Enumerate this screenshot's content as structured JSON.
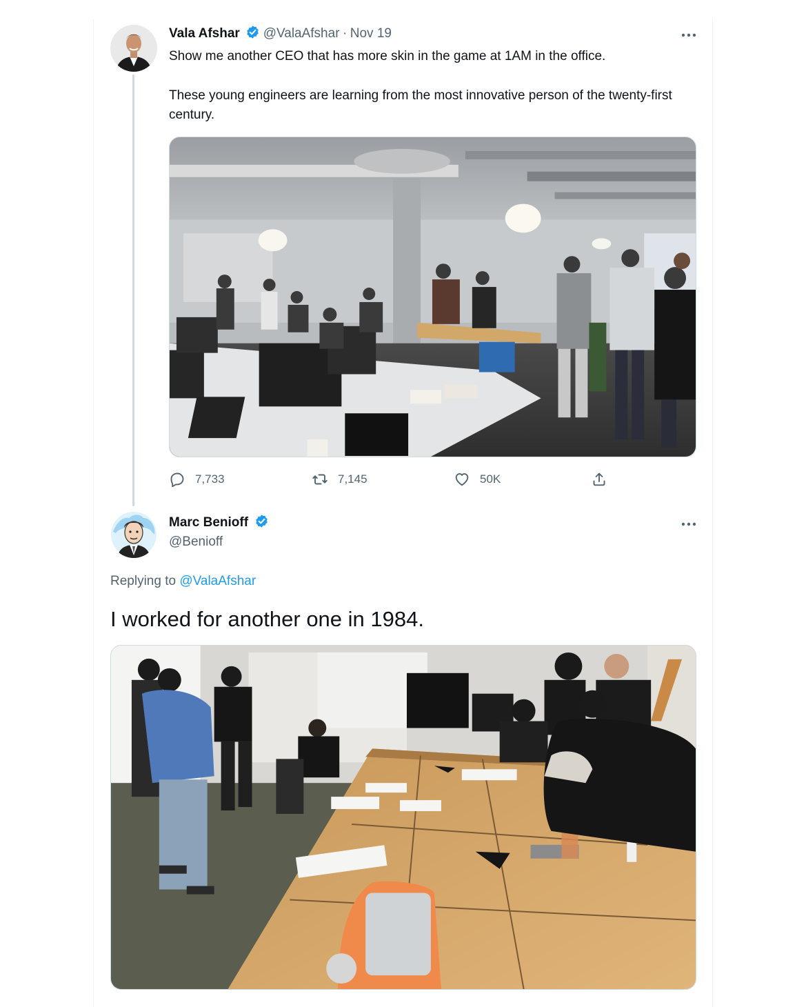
{
  "tweet1": {
    "author_name": "Vala Afshar",
    "handle": "@ValaAfshar",
    "separator": "·",
    "date": "Nov 19",
    "text_paragraphs": [
      "Show me another CEO that has more skin in the game at 1AM in the office.",
      "These young engineers are learning from the most innovative person of the twenty-first century."
    ],
    "actions": {
      "replies": "7,733",
      "retweets": "7,145",
      "likes": "50K"
    }
  },
  "tweet2": {
    "author_name": "Marc Benioff",
    "handle": "@Benioff",
    "replying_prefix": "Replying to",
    "replying_to": "@ValaAfshar",
    "text": "I worked for another one in 1984."
  },
  "colors": {
    "text_primary": "#0f1419",
    "text_secondary": "#536471",
    "accent": "#1d9bf0",
    "verified": "#1d9bf0",
    "border": "#cfd9de"
  },
  "icons": {
    "verified": "verified-badge-icon",
    "more": "more-dots-icon",
    "reply": "reply-bubble-icon",
    "retweet": "retweet-icon",
    "like": "heart-icon",
    "share": "share-upload-icon"
  }
}
